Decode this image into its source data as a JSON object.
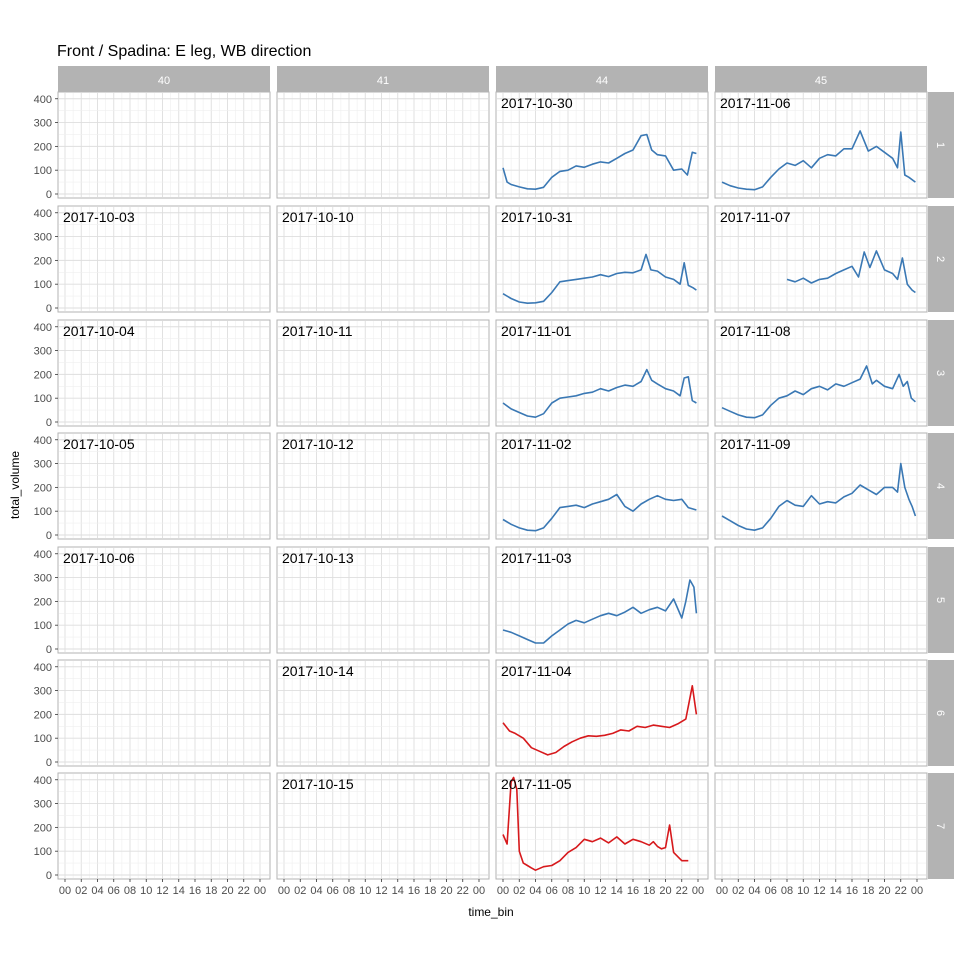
{
  "chart_data": {
    "type": "line",
    "title": "Front / Spadina: E leg, WB direction",
    "xlabel": "time_bin",
    "ylabel": "total_volume",
    "ylim": [
      0,
      420
    ],
    "y_ticks": [
      0,
      100,
      200,
      300,
      400
    ],
    "x_ticks": [
      "00",
      "02",
      "04",
      "06",
      "08",
      "10",
      "12",
      "14",
      "16",
      "18",
      "20",
      "22",
      "00"
    ],
    "xlim_hours": [
      0,
      24
    ],
    "grid": true,
    "facet_columns": [
      "40",
      "41",
      "44",
      "45"
    ],
    "facet_rows": [
      "1",
      "2",
      "3",
      "4",
      "5",
      "6",
      "7"
    ],
    "colors": {
      "weekday": "#3a78b4",
      "weekend": "#d7191c"
    },
    "panels": [
      {
        "col": 0,
        "row": 1,
        "date": "2017-10-03"
      },
      {
        "col": 0,
        "row": 2,
        "date": "2017-10-04"
      },
      {
        "col": 0,
        "row": 3,
        "date": "2017-10-05"
      },
      {
        "col": 0,
        "row": 4,
        "date": "2017-10-06"
      },
      {
        "col": 1,
        "row": 1,
        "date": "2017-10-10"
      },
      {
        "col": 1,
        "row": 2,
        "date": "2017-10-11"
      },
      {
        "col": 1,
        "row": 3,
        "date": "2017-10-12"
      },
      {
        "col": 1,
        "row": 4,
        "date": "2017-10-13"
      },
      {
        "col": 1,
        "row": 5,
        "date": "2017-10-14"
      },
      {
        "col": 1,
        "row": 6,
        "date": "2017-10-15"
      },
      {
        "col": 2,
        "row": 0,
        "date": "2017-10-30",
        "color": "weekday",
        "x": [
          0,
          0.5,
          1,
          2,
          3,
          4,
          5,
          6,
          7,
          8,
          9,
          10,
          11,
          12,
          13,
          14,
          15,
          16,
          17,
          17.7,
          18.3,
          19,
          20,
          21,
          22,
          22.7,
          23.3,
          23.8
        ],
        "y": [
          110,
          50,
          40,
          30,
          22,
          20,
          28,
          70,
          95,
          100,
          118,
          112,
          125,
          135,
          130,
          150,
          170,
          185,
          245,
          250,
          185,
          165,
          160,
          100,
          105,
          80,
          175,
          170
        ]
      },
      {
        "col": 2,
        "row": 1,
        "date": "2017-10-31",
        "color": "weekday",
        "x": [
          0,
          1,
          2,
          3,
          4,
          5,
          6,
          7,
          8,
          9,
          10,
          11,
          12,
          13,
          14,
          15,
          16,
          17,
          17.6,
          18.2,
          19,
          20,
          21,
          21.8,
          22.3,
          22.8,
          23.4,
          23.8
        ],
        "y": [
          60,
          40,
          25,
          20,
          22,
          28,
          65,
          110,
          115,
          120,
          125,
          130,
          140,
          132,
          145,
          150,
          148,
          160,
          225,
          160,
          155,
          130,
          120,
          100,
          190,
          95,
          85,
          75
        ]
      },
      {
        "col": 2,
        "row": 2,
        "date": "2017-11-01",
        "color": "weekday",
        "x": [
          0,
          1,
          2,
          3,
          4,
          5,
          6,
          7,
          8,
          9,
          10,
          11,
          12,
          13,
          14,
          15,
          16,
          17,
          17.7,
          18.3,
          19,
          20,
          21,
          21.8,
          22.3,
          22.8,
          23.3,
          23.8
        ],
        "y": [
          80,
          55,
          40,
          25,
          20,
          35,
          80,
          100,
          105,
          110,
          120,
          125,
          140,
          130,
          145,
          155,
          150,
          170,
          220,
          175,
          160,
          140,
          130,
          110,
          185,
          190,
          90,
          80
        ]
      },
      {
        "col": 2,
        "row": 3,
        "date": "2017-11-02",
        "color": "weekday",
        "x": [
          0,
          1,
          2,
          3,
          4,
          5,
          6,
          7,
          8,
          9,
          10,
          11,
          12,
          13,
          14,
          15,
          16,
          17,
          18,
          19,
          20,
          21,
          22,
          22.8,
          23.8
        ],
        "y": [
          65,
          45,
          30,
          20,
          18,
          30,
          70,
          115,
          120,
          125,
          115,
          130,
          140,
          150,
          170,
          120,
          100,
          130,
          150,
          165,
          150,
          145,
          150,
          115,
          105
        ]
      },
      {
        "col": 2,
        "row": 4,
        "date": "2017-11-03",
        "color": "weekday",
        "x": [
          0,
          1,
          2,
          3,
          4,
          5,
          6,
          7,
          8,
          9,
          10,
          11,
          12,
          13,
          14,
          15,
          16,
          17,
          18,
          19,
          20,
          21,
          22,
          22.5,
          23,
          23.5,
          23.8
        ],
        "y": [
          80,
          70,
          55,
          40,
          25,
          25,
          55,
          80,
          105,
          120,
          110,
          125,
          140,
          150,
          140,
          155,
          175,
          150,
          165,
          175,
          160,
          210,
          130,
          200,
          290,
          260,
          150
        ]
      },
      {
        "col": 2,
        "row": 5,
        "date": "2017-11-04",
        "color": "weekend",
        "x": [
          0,
          0.8,
          1.5,
          2.5,
          3.5,
          4.5,
          5.5,
          6.5,
          7.5,
          8.5,
          9.5,
          10.5,
          11.5,
          12.5,
          13.5,
          14.5,
          15.5,
          16.5,
          17.5,
          18.5,
          19.5,
          20.5,
          21.5,
          22.5,
          23.3,
          23.8
        ],
        "y": [
          165,
          130,
          120,
          100,
          60,
          45,
          30,
          40,
          65,
          85,
          100,
          110,
          108,
          112,
          120,
          135,
          130,
          150,
          145,
          155,
          150,
          145,
          160,
          180,
          320,
          200
        ]
      },
      {
        "col": 2,
        "row": 6,
        "date": "2017-11-05",
        "color": "weekend",
        "x": [
          0,
          0.5,
          1,
          1.3,
          1.7,
          2,
          2.5,
          3,
          3.5,
          4,
          5,
          6,
          7,
          8,
          9,
          10,
          11,
          12,
          13,
          14,
          15,
          16,
          17,
          18,
          18.5,
          19,
          19.5,
          20,
          20.5,
          21,
          22,
          22.8
        ],
        "y": [
          170,
          130,
          390,
          410,
          360,
          100,
          50,
          40,
          30,
          20,
          35,
          40,
          60,
          95,
          115,
          150,
          140,
          155,
          135,
          160,
          130,
          150,
          140,
          125,
          140,
          120,
          110,
          115,
          210,
          95,
          60,
          60
        ]
      },
      {
        "col": 3,
        "row": 0,
        "date": "2017-11-06",
        "color": "weekday",
        "x": [
          0,
          1,
          2,
          3,
          4,
          5,
          6,
          7,
          8,
          9,
          10,
          11,
          12,
          13,
          14,
          15,
          16,
          17,
          18,
          19,
          20,
          21,
          21.6,
          22,
          22.5,
          23,
          23.8
        ],
        "y": [
          50,
          35,
          25,
          20,
          18,
          30,
          70,
          105,
          130,
          120,
          140,
          110,
          150,
          165,
          160,
          190,
          190,
          265,
          180,
          200,
          175,
          150,
          110,
          260,
          80,
          70,
          50
        ]
      },
      {
        "col": 3,
        "row": 1,
        "date": "2017-11-07",
        "color": "weekday",
        "x": [
          8,
          9,
          10,
          11,
          12,
          13,
          14,
          15,
          16,
          16.8,
          17.5,
          18.2,
          19,
          20,
          21,
          21.6,
          22.2,
          22.8,
          23.4,
          23.8
        ],
        "y": [
          120,
          110,
          125,
          105,
          120,
          125,
          145,
          160,
          175,
          130,
          235,
          170,
          240,
          160,
          145,
          120,
          210,
          100,
          75,
          65
        ]
      },
      {
        "col": 3,
        "row": 2,
        "date": "2017-11-08",
        "color": "weekday",
        "x": [
          0,
          1,
          2,
          3,
          4,
          5,
          6,
          7,
          8,
          9,
          10,
          11,
          12,
          13,
          14,
          15,
          16,
          17,
          17.8,
          18.5,
          19,
          20,
          21,
          21.8,
          22.3,
          22.8,
          23.3,
          23.8
        ],
        "y": [
          60,
          45,
          30,
          20,
          18,
          30,
          70,
          100,
          110,
          130,
          115,
          140,
          150,
          135,
          160,
          150,
          165,
          180,
          235,
          160,
          175,
          150,
          140,
          200,
          150,
          170,
          100,
          85
        ]
      },
      {
        "col": 3,
        "row": 3,
        "date": "2017-11-09",
        "color": "weekday",
        "x": [
          0,
          1,
          2,
          3,
          4,
          5,
          6,
          7,
          8,
          9,
          10,
          11,
          12,
          13,
          14,
          15,
          16,
          17,
          18,
          19,
          20,
          21,
          21.6,
          22,
          22.5,
          23,
          23.4,
          23.8
        ],
        "y": [
          80,
          60,
          40,
          25,
          20,
          30,
          70,
          120,
          145,
          125,
          120,
          165,
          130,
          140,
          135,
          160,
          175,
          210,
          190,
          170,
          200,
          200,
          180,
          300,
          200,
          150,
          120,
          80
        ]
      }
    ]
  }
}
